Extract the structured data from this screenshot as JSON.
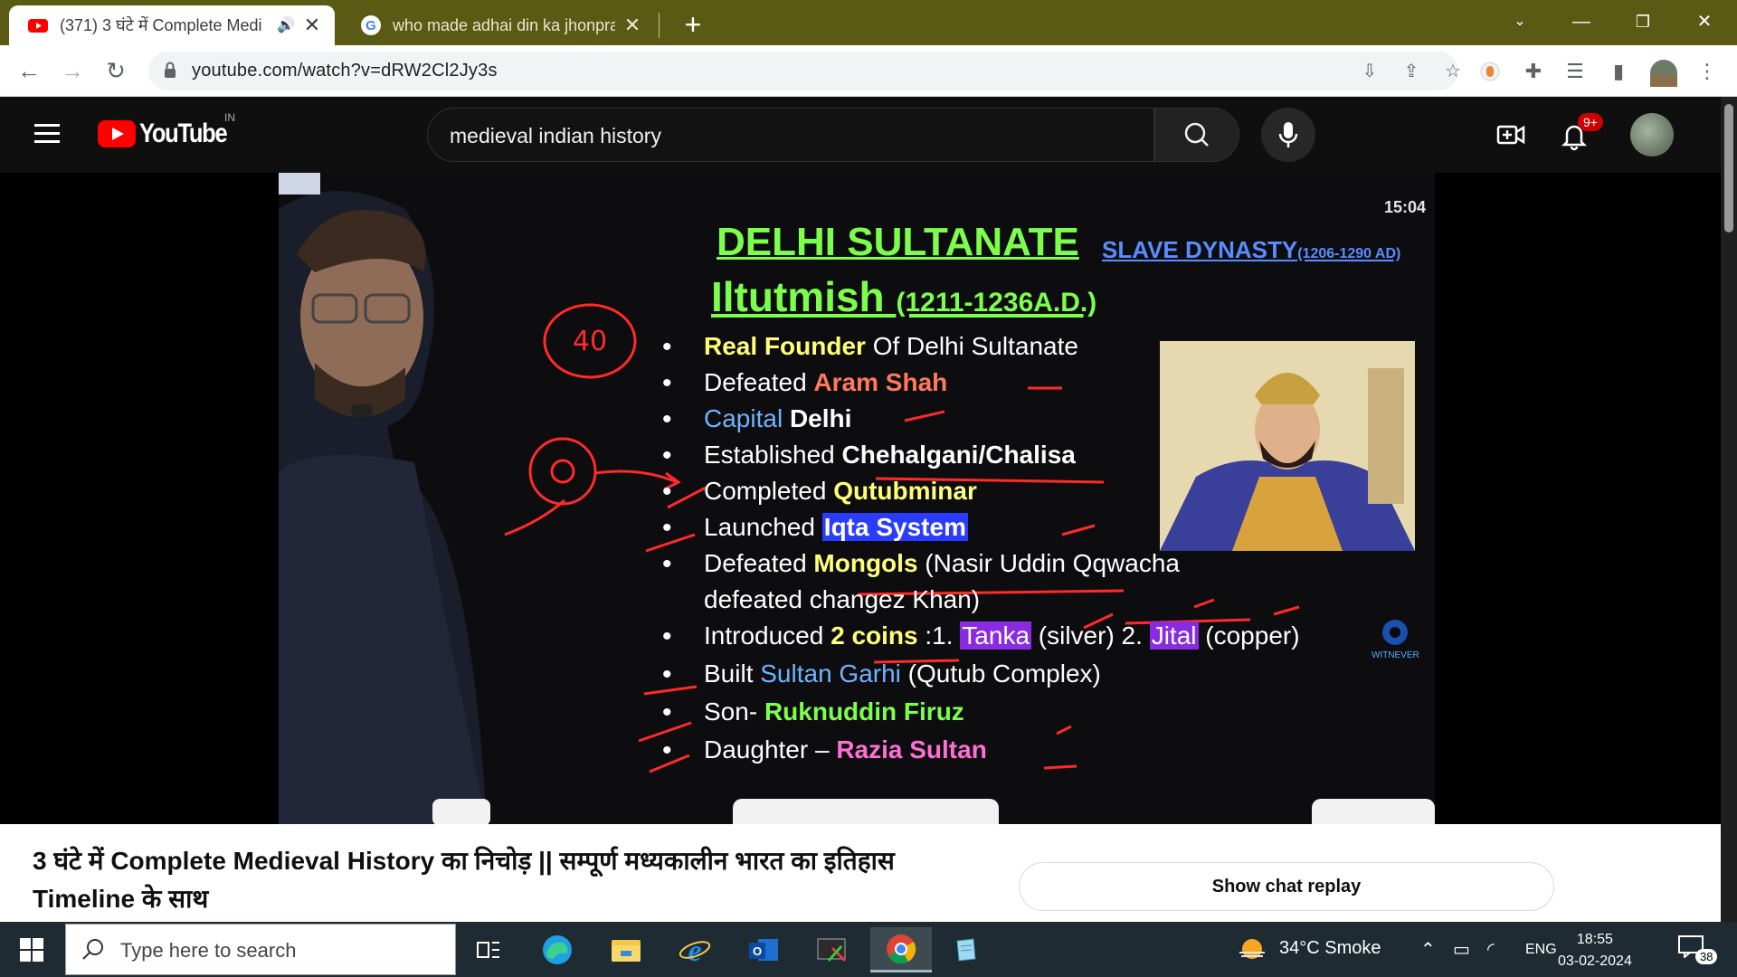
{
  "browser": {
    "tabs": [
      {
        "title": "(371) 3 घंटे में Complete Medi",
        "active": true,
        "icon": "youtube-icon",
        "audio": true
      },
      {
        "title": "who made adhai din ka jhonpra",
        "active": false,
        "icon": "google-icon"
      }
    ],
    "new_tab_label": "+",
    "url": "youtube.com/watch?v=dRW2Cl2Jy3s"
  },
  "youtube": {
    "brand": "YouTube",
    "region": "IN",
    "search_query": "medieval indian history",
    "notification_count": "9+"
  },
  "video": {
    "timer": "15:04",
    "slide": {
      "title": "DELHI SULTANATE",
      "dynasty": "SLAVE DYNASTY",
      "dynasty_years": "(1206-1290 AD)",
      "ruler": "Iltutmish",
      "ruler_years": "(1211-1236A.D.)",
      "annotation_circle": "40",
      "bullets": [
        {
          "a": "Real Founder",
          "b": " Of Delhi Sultanate"
        },
        {
          "a": "Defeated ",
          "b": "Aram Shah"
        },
        {
          "a": "Capital ",
          "b": "Delhi"
        },
        {
          "a": "Established ",
          "b": "Chehalgani/Chalisa"
        },
        {
          "a": "Completed ",
          "b": "Qutubminar"
        },
        {
          "a": "Launched ",
          "b": "Iqta System"
        },
        {
          "a": "Defeated ",
          "b": "Mongols",
          "c": " (Nasir Uddin Qqwacha"
        },
        {
          "a": "defeated changez Khan)"
        },
        {
          "a": "Introduced ",
          "b": "2 coins",
          "c": " :1. ",
          "d": "Tanka",
          "e": " (silver) 2. ",
          "f": "Jital",
          "g": " (copper)"
        },
        {
          "a": "Built ",
          "b": "Sultan Garhi",
          "c": " (Qutub Complex)"
        },
        {
          "a": "Son- ",
          "b": "Ruknuddin Firuz"
        },
        {
          "a": "Daughter – ",
          "b": "Razia Sultan"
        }
      ],
      "watermark": "WITNEVER"
    }
  },
  "below_video": {
    "title": "3 घंटे में Complete Medieval History का निचोड़ || सम्पूर्ण मध्यकालीन भारत का इतिहास Timeline के साथ",
    "chat_button": "Show chat replay"
  },
  "taskbar": {
    "search_placeholder": "Type here to search",
    "weather": "34°C  Smoke",
    "language": "ENG",
    "time": "18:55",
    "date": "03-02-2024",
    "notifications": "38"
  },
  "colors": {
    "tabstrip": "#5a5a14",
    "yt_bg": "#0f0f0f",
    "yt_red": "#ff0000",
    "taskbar": "#1e2b32"
  }
}
